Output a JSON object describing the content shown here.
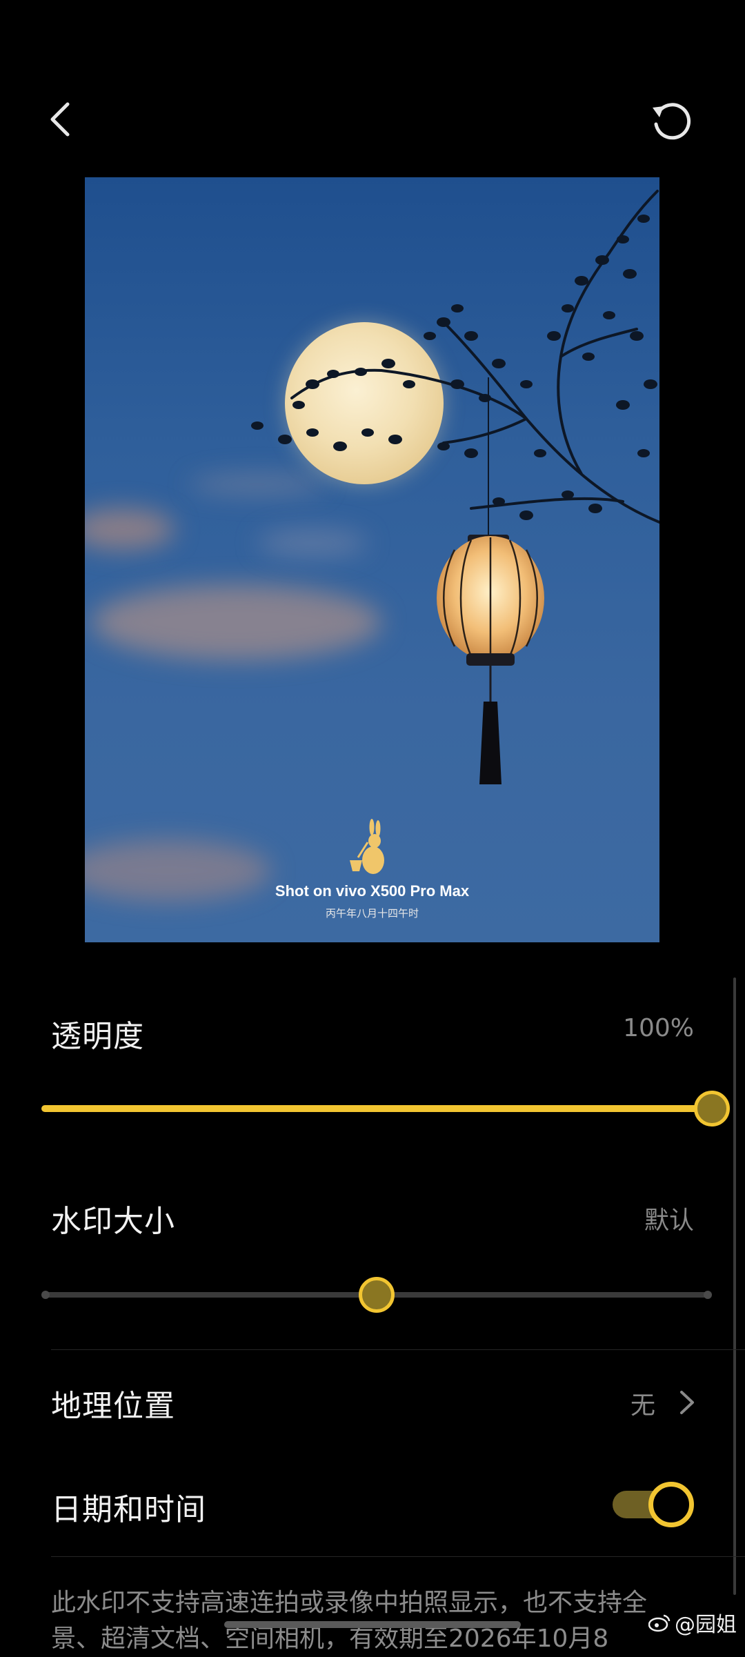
{
  "topbar": {
    "back_icon": "chevron-left-icon",
    "reset_icon": "rotate-ccw-icon"
  },
  "preview": {
    "watermark_title": "Shot on vivo X500 Pro Max",
    "watermark_date": "丙午年八月十四午时",
    "logo_icon": "rabbit-logo"
  },
  "settings": {
    "opacity": {
      "label": "透明度",
      "value": "100%",
      "level": 1.0
    },
    "size": {
      "label": "水印大小",
      "value": "默认",
      "level": 0.5
    },
    "location": {
      "label": "地理位置",
      "value": "无"
    },
    "datetime": {
      "label": "日期和时间",
      "enabled": true
    }
  },
  "footnote": "此水印不支持高速连拍或录像中拍照显示，也不支持全景、超清文档、空间相机，有效期至2026年10月8",
  "weibo_handle": "@园姐",
  "colors": {
    "accent": "#f2c531",
    "background": "#000000",
    "sky": "#2f5f9b"
  }
}
